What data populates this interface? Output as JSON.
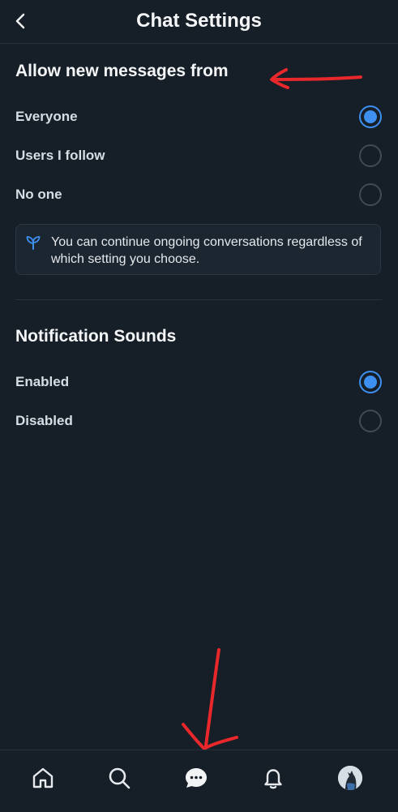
{
  "header": {
    "title": "Chat Settings",
    "back_icon": "chevron-left-icon"
  },
  "messages_section": {
    "title": "Allow new messages from",
    "options": [
      {
        "label": "Everyone",
        "selected": true
      },
      {
        "label": "Users I follow",
        "selected": false
      },
      {
        "label": "No one",
        "selected": false
      }
    ],
    "info": {
      "icon": "sprout-icon",
      "text": "You can continue ongoing conversations regardless of which setting you choose."
    }
  },
  "sounds_section": {
    "title": "Notification Sounds",
    "options": [
      {
        "label": "Enabled",
        "selected": true
      },
      {
        "label": "Disabled",
        "selected": false
      }
    ]
  },
  "bottom_nav": {
    "items": [
      "home-icon",
      "search-icon",
      "chat-icon",
      "bell-icon",
      "avatar"
    ]
  },
  "colors": {
    "background": "#161e27",
    "accent": "#3d8ff0",
    "annotation": "#e8282b"
  }
}
